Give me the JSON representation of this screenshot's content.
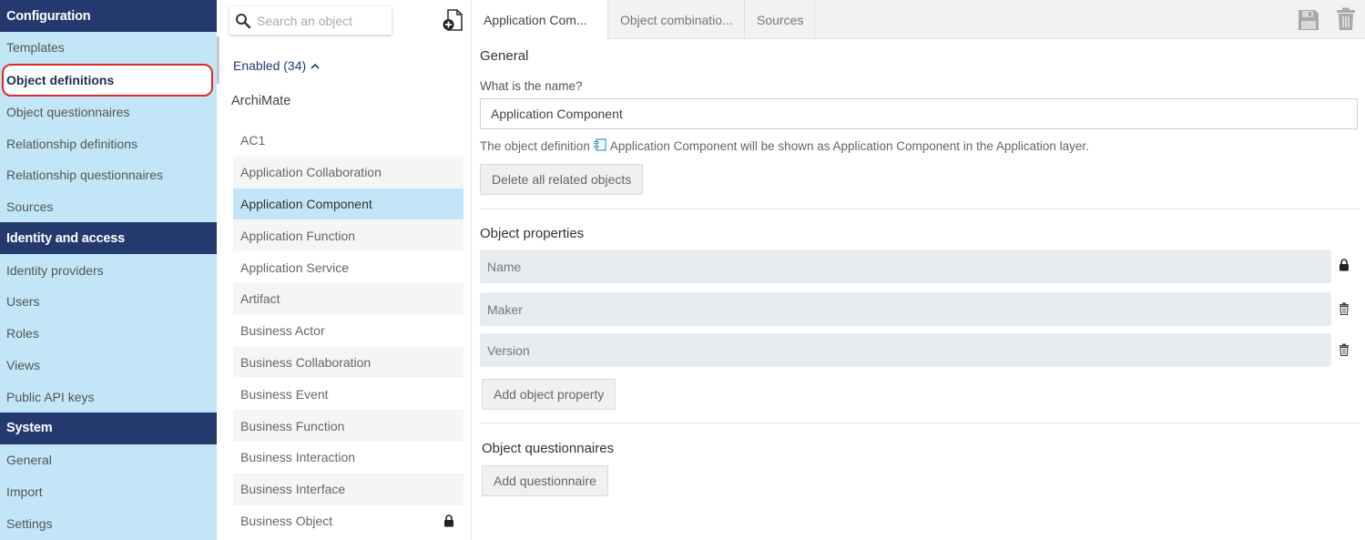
{
  "nav": {
    "sections": [
      {
        "title": "Configuration",
        "items": [
          "Templates",
          "Object definitions",
          "Object questionnaires",
          "Relationship definitions",
          "Relationship questionnaires",
          "Sources"
        ]
      },
      {
        "title": "Identity and access",
        "items": [
          "Identity providers",
          "Users",
          "Roles",
          "Views",
          "Public API keys"
        ]
      },
      {
        "title": "System",
        "items": [
          "General",
          "Import",
          "Settings"
        ]
      }
    ],
    "active_item": "Object definitions"
  },
  "list": {
    "search_placeholder": "Search an object",
    "enabled_label": "Enabled (34)",
    "group_title": "ArchiMate",
    "items": [
      {
        "label": "AC1"
      },
      {
        "label": "Application Collaboration"
      },
      {
        "label": "Application Component",
        "selected": true
      },
      {
        "label": "Application Function"
      },
      {
        "label": "Application Service"
      },
      {
        "label": "Artifact"
      },
      {
        "label": "Business Actor"
      },
      {
        "label": "Business Collaboration"
      },
      {
        "label": "Business Event"
      },
      {
        "label": "Business Function"
      },
      {
        "label": "Business Interaction"
      },
      {
        "label": "Business Interface"
      },
      {
        "label": "Business Object",
        "locked": true
      }
    ]
  },
  "tabs": [
    "Application Com...",
    "Object combinatio...",
    "Sources"
  ],
  "detail": {
    "general_title": "General",
    "name_question": "What is the name?",
    "name_value": "Application Component",
    "desc_prefix": "The object definition",
    "desc_suffix": "Application Component will be shown as Application Component in the Application layer.",
    "delete_button": "Delete all related objects",
    "properties_title": "Object properties",
    "properties": [
      {
        "label": "Name",
        "action": "lock-icon"
      },
      {
        "label": "Maker",
        "action": "trash-icon"
      },
      {
        "label": "Version",
        "action": "trash-icon"
      }
    ],
    "add_property_button": "Add object property",
    "questionnaires_title": "Object questionnaires",
    "add_questionnaire_button": "Add questionnaire"
  },
  "colors": {
    "nav_bg": "#c2e6f8",
    "nav_section_bg": "#243a6e",
    "highlight": "#e02a2a",
    "selected_row": "#c2e6f8"
  }
}
